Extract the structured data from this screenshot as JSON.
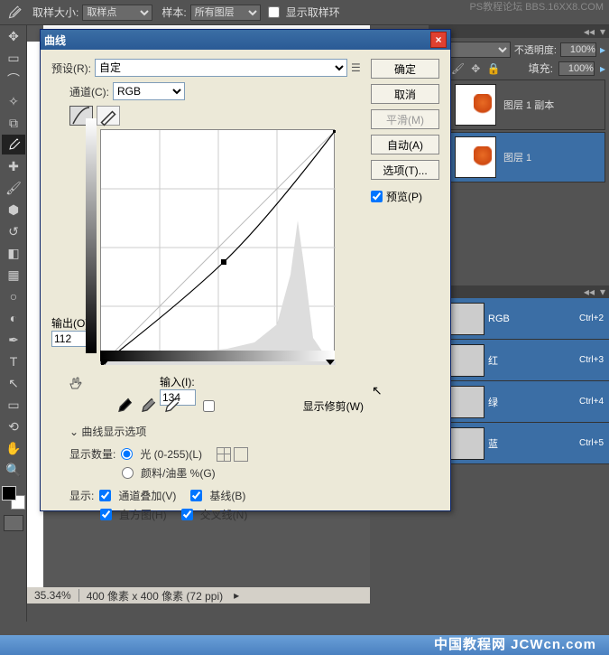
{
  "watermark_top": "PS教程论坛\nBBS.16XX8.COM",
  "watermark_bottom": "中国教程网  JCWcn.com",
  "options_bar": {
    "sample_size_label": "取样大小:",
    "sample_size_value": "取样点",
    "sample_label": "样本:",
    "sample_value": "所有图层",
    "show_ring_label": "显示取样环"
  },
  "status": {
    "zoom": "35.34%",
    "doc_info": "400 像素 x 400 像素 (72 ppi)"
  },
  "layers": {
    "opacity_label": "不透明度:",
    "opacity_value": "100%",
    "fill_label": "填充:",
    "fill_value": "100%",
    "items": [
      {
        "name": "图层 1 副本",
        "selected": false
      },
      {
        "name": "图层 1",
        "selected": true
      }
    ]
  },
  "channels": [
    {
      "name": "RGB",
      "shortcut": "Ctrl+2"
    },
    {
      "name": "红",
      "shortcut": "Ctrl+3"
    },
    {
      "name": "绿",
      "shortcut": "Ctrl+4"
    },
    {
      "name": "蓝",
      "shortcut": "Ctrl+5"
    }
  ],
  "dialog": {
    "title": "曲线",
    "preset_label": "预设(R):",
    "preset_value": "自定",
    "channel_label": "通道(C):",
    "channel_value": "RGB",
    "output_label": "输出(O):",
    "output_value": "112",
    "input_label": "输入(I):",
    "input_value": "134",
    "show_clip_label": "显示修剪(W)",
    "options_header": "曲线显示选项",
    "amount_label": "显示数量:",
    "amount_light": "光 (0-255)(L)",
    "amount_pigment": "颜料/油墨 %(G)",
    "show_label": "显示:",
    "cb_channel_overlay": "通道叠加(V)",
    "cb_baseline": "基线(B)",
    "cb_histogram": "直方图(H)",
    "cb_intersection": "交叉线(N)",
    "btn_ok": "确定",
    "btn_cancel": "取消",
    "btn_smooth": "平滑(M)",
    "btn_auto": "自动(A)",
    "btn_options": "选项(T)...",
    "cb_preview": "预览(P)"
  },
  "chart_data": {
    "type": "line",
    "title": "曲线",
    "xlabel": "输入",
    "ylabel": "输出",
    "xlim": [
      0,
      255
    ],
    "ylim": [
      0,
      255
    ],
    "points": [
      {
        "x": 0,
        "y": 0
      },
      {
        "x": 134,
        "y": 112
      },
      {
        "x": 255,
        "y": 255
      }
    ],
    "baseline": [
      {
        "x": 0,
        "y": 0
      },
      {
        "x": 255,
        "y": 255
      }
    ]
  }
}
